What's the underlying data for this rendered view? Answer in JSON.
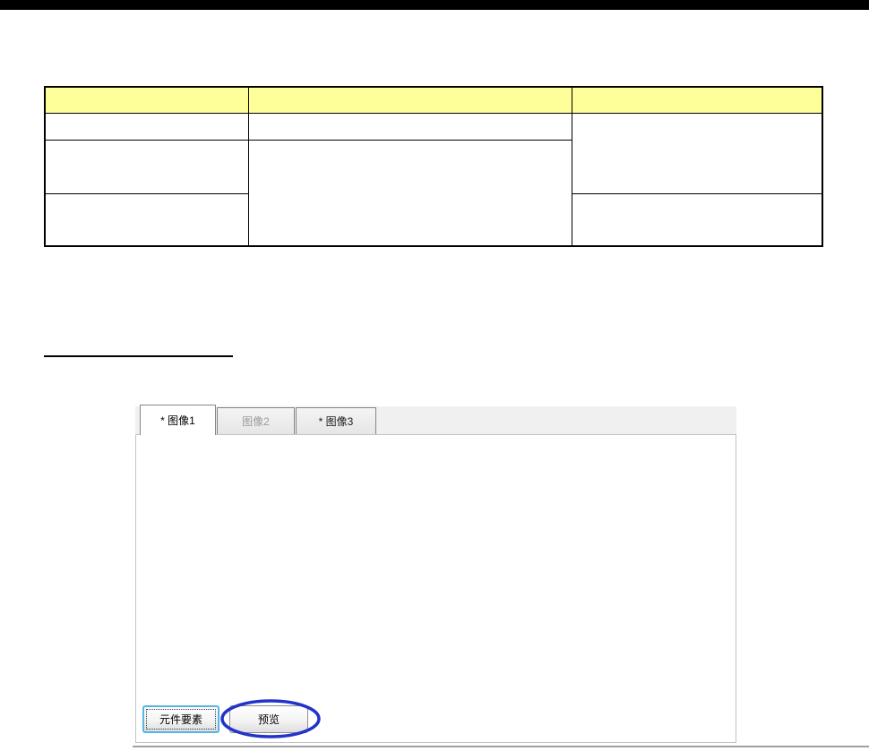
{
  "document": {
    "table": {
      "header_bg": "#ffff99",
      "header": [
        "",
        "",
        ""
      ],
      "rows": [
        [
          "",
          "",
          ""
        ],
        [
          "",
          ""
        ],
        [
          "",
          ""
        ]
      ]
    }
  },
  "widget": {
    "tabs": [
      {
        "label": "* 图像1",
        "state": "active"
      },
      {
        "label": "图像2",
        "state": "dimmed"
      },
      {
        "label": "* 图像3",
        "state": "normal"
      }
    ],
    "buttons": {
      "element_list": "元件要素",
      "preview": "预览"
    },
    "annotation": {
      "shape": "ellipse",
      "color": "#2233cc",
      "around_button": "预览"
    }
  },
  "colors": {
    "table_header_bg": "#ffff99",
    "focused_button_border": "#54b5e6",
    "annotation_blue": "#2233cc",
    "top_bar": "#000000"
  }
}
